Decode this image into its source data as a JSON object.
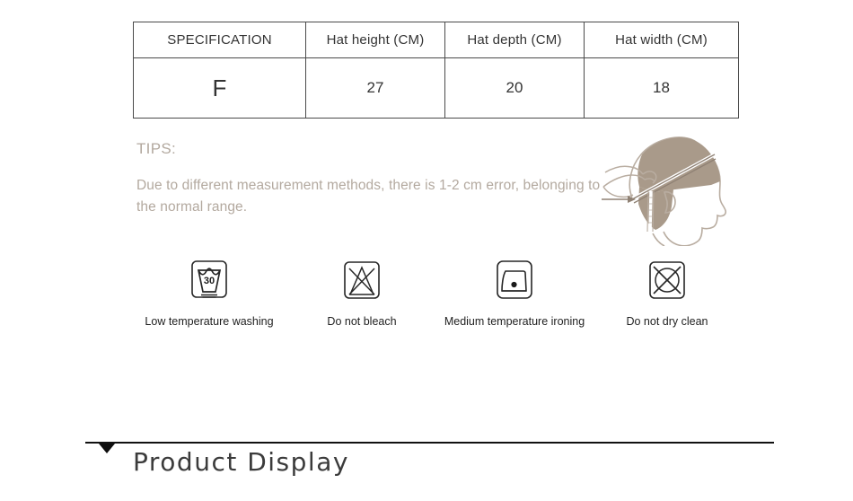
{
  "spec_table": {
    "headers": [
      "SPECIFICATION",
      "Hat height (CM)",
      "Hat depth (CM)",
      "Hat width (CM)"
    ],
    "rows": [
      [
        "F",
        "27",
        "20",
        "18"
      ]
    ]
  },
  "tips": {
    "title": "TIPS:",
    "body": "Due to different measurement methods, there is 1-2 cm error, belonging to the normal range."
  },
  "illustration": {
    "name": "head-measure-illustration",
    "fill_color": "#a99a8a",
    "line_color": "#a99a8a"
  },
  "care_instructions": [
    {
      "icon": "low-temperature-washing-icon",
      "temperature": "30",
      "label": "Low temperature washing"
    },
    {
      "icon": "do-not-bleach-icon",
      "label": "Do not bleach"
    },
    {
      "icon": "medium-temperature-ironing-icon",
      "label": "Medium temperature ironing"
    },
    {
      "icon": "do-not-dry-clean-icon",
      "label": "Do not dry clean"
    }
  ],
  "product_display": {
    "title": "Product Display",
    "marker_icon": "triangle-down-icon"
  },
  "colors": {
    "text_dark": "#333333",
    "tips_taupe": "#b3a99f",
    "illustration_taupe": "#a99a8a",
    "rule_black": "#111111",
    "table_border": "#4a4a4a"
  }
}
